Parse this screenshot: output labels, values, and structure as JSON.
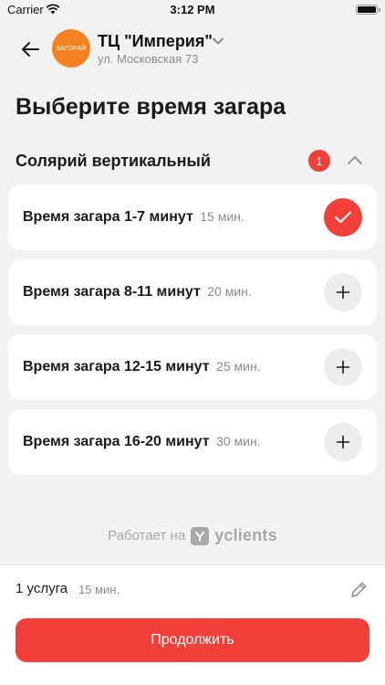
{
  "status_bar": {
    "carrier": "Carrier",
    "time": "3:12 PM",
    "battery_level": 1.0
  },
  "header": {
    "logo_text": "ЗАГОРАЙ",
    "salon_name": "ТЦ \"Империя\"",
    "address": "ул. Московская 73"
  },
  "page_title": "Выберите время загара",
  "category": {
    "title": "Солярий вертикальный",
    "badge_count": "1",
    "expanded": true
  },
  "services": [
    {
      "name": "Время загара 1-7 минут",
      "duration": "15 мин.",
      "selected": true
    },
    {
      "name": "Время загара 8-11 минут",
      "duration": "20 мин.",
      "selected": false
    },
    {
      "name": "Время загара 12-15 минут",
      "duration": "25 мин.",
      "selected": false
    },
    {
      "name": "Время загара 16-20 минут",
      "duration": "30 мин.",
      "selected": false
    }
  ],
  "powered_by": {
    "prefix": "Работает на",
    "brand": "yclients"
  },
  "summary": {
    "count": "1 услуга",
    "duration": "15 мин."
  },
  "continue_label": "Продолжить",
  "colors": {
    "accent": "#f33f3a",
    "logo": "#f58220",
    "background": "#f2f2f2"
  },
  "icons": {
    "back": "arrow-left-icon",
    "chevron": "chevron-down-icon",
    "collapse": "chevron-up-icon",
    "selected": "checkmark-icon",
    "add": "plus-icon",
    "edit": "pencil-icon"
  }
}
